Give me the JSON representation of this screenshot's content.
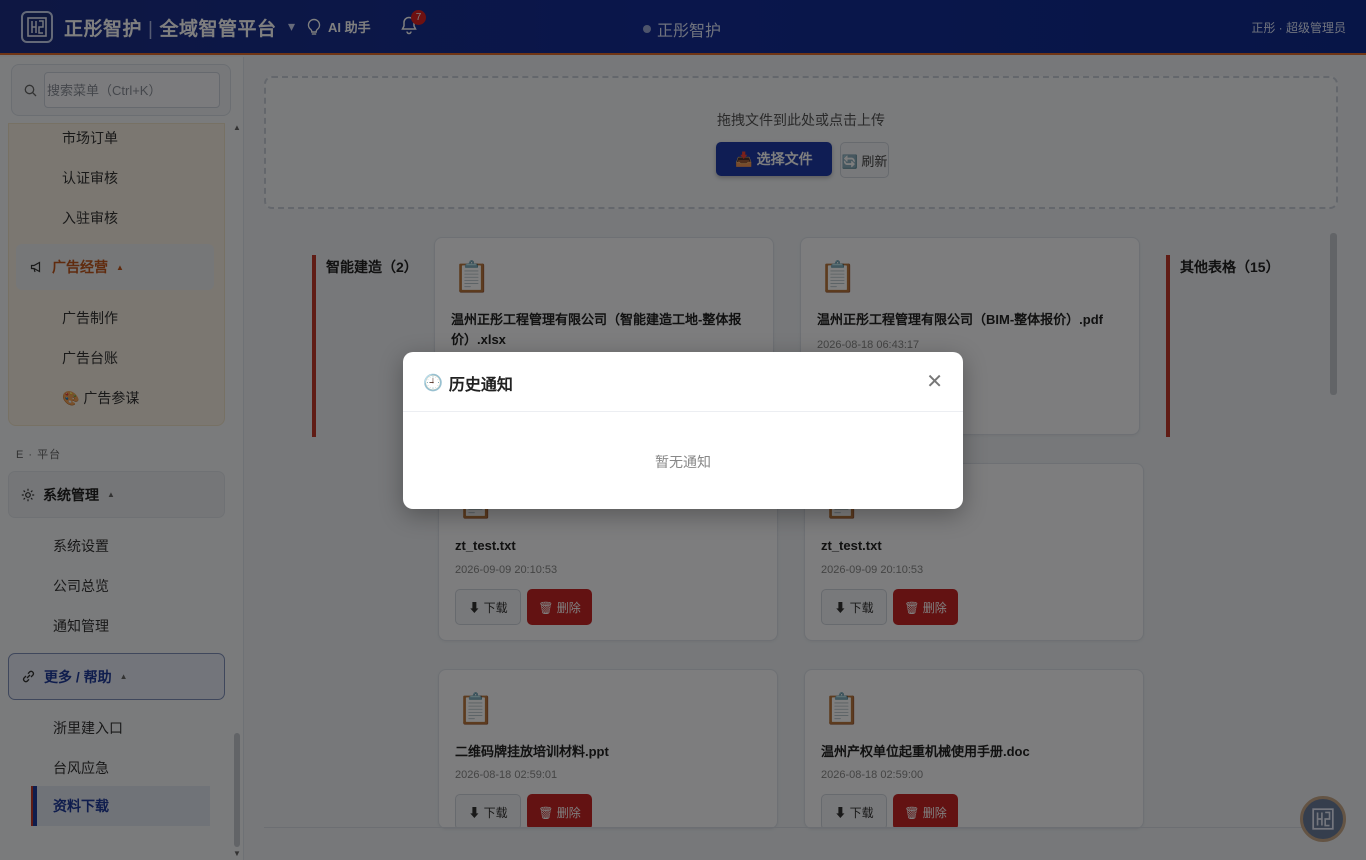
{
  "header": {
    "brand_name": "正彤智护",
    "brand_platform": "全域智管平台",
    "caret": "▾",
    "ai_label": "AI 助手",
    "bell_count": "7",
    "center_title": "正彤智护",
    "user": "正彤 · 超级管理员"
  },
  "sidebar": {
    "search_placeholder": "搜索菜单（Ctrl+K）",
    "market_items": [
      "市场订单",
      "认证审核",
      "入驻审核"
    ],
    "ad_group_label": "广告经营",
    "ad_items": [
      "广告制作",
      "广告台账",
      "🎨 广告参谋"
    ],
    "section_label": "E · 平台",
    "sys_group_label": "系统管理",
    "sys_items": [
      "系统设置",
      "公司总览",
      "通知管理"
    ],
    "help_group_label": "更多 / 帮助",
    "help_items": [
      "浙里建入口",
      "台风应急"
    ],
    "active_item": "资料下载",
    "tri": "▲"
  },
  "upload": {
    "hint": "拖拽文件到此处或点击上传",
    "choose_label": "📥 选择文件",
    "refresh_label": "🔄 刷新"
  },
  "categories": [
    {
      "title": "智能建造（2）"
    },
    {
      "title": "其他表格（15）"
    }
  ],
  "files": [
    {
      "icon": "📋",
      "name": "温州正彤工程管理有限公司（智能建造工地-整体报价）.xlsx",
      "date": ""
    },
    {
      "icon": "📋",
      "name": "温州正彤工程管理有限公司（BIM-整体报价）.pdf",
      "date": "2026-08-18 06:43:17"
    },
    {
      "icon": "📋",
      "name": "zt_test.txt",
      "date": "2026-09-09 20:10:53"
    },
    {
      "icon": "📋",
      "name": "zt_test.txt",
      "date": "2026-09-09 20:10:53"
    },
    {
      "icon": "📋",
      "name": "二维码牌挂放培训材料.ppt",
      "date": "2026-08-18 02:59:01"
    },
    {
      "icon": "📋",
      "name": "温州产权单位起重机械使用手册.doc",
      "date": "2026-08-18 02:59:00"
    }
  ],
  "actions": {
    "download": "⬇ 下载",
    "delete": "🗑 删除"
  },
  "modal": {
    "title": "历史通知",
    "clock_icon": "🕘",
    "close": "✕",
    "empty": "暂无通知"
  },
  "colors": {
    "header": "#142d97",
    "accent_orange": "#e06b2b",
    "primary": "#1f3aa8",
    "danger": "#c62424",
    "category_bar": "#c0392b"
  }
}
